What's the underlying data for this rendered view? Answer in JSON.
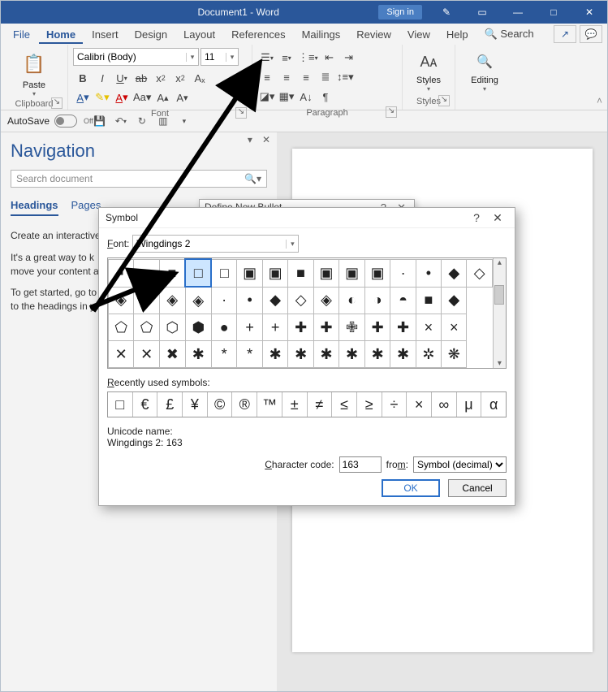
{
  "titlebar": {
    "doc": "Document1 - Word",
    "sign_in": "Sign in"
  },
  "menu": {
    "file": "File",
    "home": "Home",
    "insert": "Insert",
    "design": "Design",
    "layout": "Layout",
    "references": "References",
    "mailings": "Mailings",
    "review": "Review",
    "view": "View",
    "help": "Help",
    "search": "Search"
  },
  "ribbon": {
    "clipboard": {
      "label": "Clipboard",
      "paste": "Paste"
    },
    "font": {
      "label": "Font",
      "family": "Calibri (Body)",
      "size": "11"
    },
    "paragraph": {
      "label": "Paragraph"
    },
    "styles": {
      "label": "Styles",
      "btn": "Styles"
    },
    "editing": {
      "label": "",
      "btn": "Editing"
    }
  },
  "qat": {
    "autosave_label": "AutoSave",
    "autosave_state": "Off"
  },
  "nav": {
    "title": "Navigation",
    "search_placeholder": "Search document",
    "tabs": {
      "headings": "Headings",
      "pages": "Pages"
    },
    "body1": "Create an interactive",
    "body2": "It's a great way to k",
    "body3": "move your content a",
    "body4": "To get started, go to",
    "body5": "to the headings in yo"
  },
  "under_dialog": {
    "title": "Define New Bullet"
  },
  "dialog": {
    "title": "Symbol",
    "font_label": "Font:",
    "font_value": "Wingdings 2",
    "recent_label": "Recently used symbols:",
    "unicode_label": "Unicode name:",
    "unicode_value": "Wingdings 2: 163",
    "charcode_label": "Character code:",
    "charcode_value": "163",
    "from_label": "from:",
    "from_value": "Symbol (decimal)",
    "ok": "OK",
    "cancel": "Cancel",
    "grid_rows": [
      [
        "▪",
        "■",
        "■",
        "□",
        "□",
        "▣",
        "▣",
        "■",
        "▣",
        "▣",
        "▣",
        "·",
        "•",
        "◆",
        "◇"
      ],
      [
        "◈",
        "◈",
        "◈",
        "◈",
        "·",
        "•",
        "◆",
        "◇",
        "◈",
        "◐",
        "◑",
        "◓",
        "■",
        "◆"
      ],
      [
        "⬠",
        "⬠",
        "⬡",
        "⬢",
        "●",
        "+",
        "+",
        "✚",
        "✚",
        "✙",
        "✚",
        "✚",
        "×",
        "×"
      ],
      [
        "✕",
        "✕",
        "✖",
        "✱",
        "*",
        "*",
        "✱",
        "✱",
        "✱",
        "✱",
        "✱",
        "✱",
        "✲",
        "❋"
      ]
    ],
    "selected_row": 0,
    "selected_col": 3,
    "recent": [
      "□",
      "€",
      "£",
      "¥",
      "©",
      "®",
      "™",
      "±",
      "≠",
      "≤",
      "≥",
      "÷",
      "×",
      "∞",
      "μ",
      "α"
    ]
  }
}
